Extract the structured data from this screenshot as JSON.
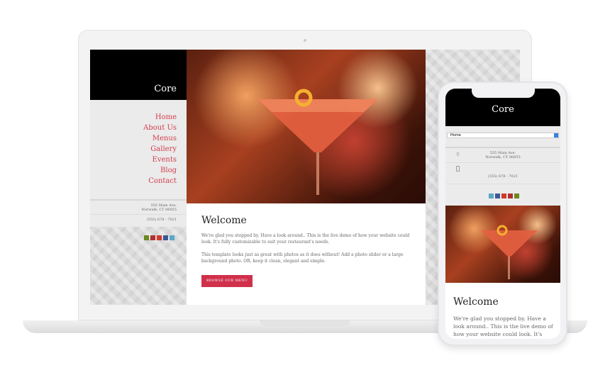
{
  "site": {
    "title": "Core",
    "nav": [
      "Home",
      "About Us",
      "Menus",
      "Gallery",
      "Events",
      "Blog",
      "Contact"
    ],
    "address_line1": "555 Main Ave.",
    "address_line2": "Norwalk, CT 06855",
    "phone": "(555) 678 - 7021",
    "welcome": {
      "heading": "Welcome",
      "p1": "We're glad you stopped by.  Have a look around..  This is the live demo of how your website could look.  It's fully customizable to suit your restaurant's needs.",
      "p2": "This template looks just as great with photos as it does without!  Add a photo slider or a large background photo.  OR, keep it clean, elegant and simple.",
      "button": "BROWSE OUR MENU"
    },
    "mobile_select": "Home",
    "mobile_p1": "We're glad you stopped by.  Have a look around..  This is the live demo of how your website could look.  It's fully customizable to suit your restaurant's"
  },
  "colors": {
    "accent": "#d0304a",
    "header": "#000000",
    "sidebar": "#ebebeb"
  },
  "social_icons": [
    "tripadvisor-icon",
    "yelp-icon",
    "google-plus-icon",
    "facebook-icon",
    "twitter-icon"
  ]
}
